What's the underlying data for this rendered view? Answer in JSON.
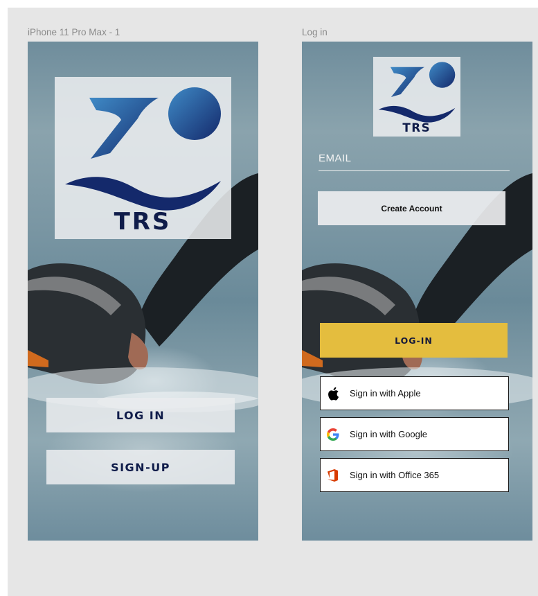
{
  "frames": [
    {
      "label": "iPhone 11 Pro Max - 1",
      "logo_text": "TRS",
      "buttons": {
        "login": "LOG IN",
        "signup": "SIGN-UP"
      }
    },
    {
      "label": "Log in",
      "logo_text": "TRS",
      "email": {
        "label": "EMAIL"
      },
      "create_account": "Create Account",
      "login": "LOG-IN",
      "sso": [
        {
          "label": "Sign in with Apple",
          "icon": "apple-icon"
        },
        {
          "label": "Sign in with Google",
          "icon": "google-icon"
        },
        {
          "label": "Sign in with Office 365",
          "icon": "office365-icon"
        }
      ]
    }
  ],
  "colors": {
    "canvas": "#e6e6e6",
    "brand_navy": "#0f1c4a",
    "brand_blue": "#3a7fc0",
    "accent_yellow": "#e4bd3e"
  }
}
